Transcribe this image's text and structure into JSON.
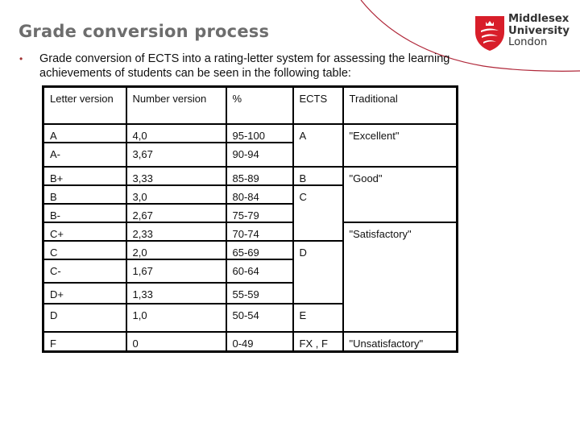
{
  "slide": {
    "title": "Grade conversion process",
    "bullet_symbol": "•",
    "bullet_text": "Grade conversion of ECTS into a rating-letter system for assessing the learning achievements of students can be seen in the following table:"
  },
  "logo": {
    "line1": "Middlesex",
    "line2": "University",
    "line3": "London",
    "brand_color": "#d81e2a"
  },
  "table": {
    "headers": [
      "Letter version",
      "Number version",
      "%",
      "ECTS",
      "Traditional"
    ],
    "rows": [
      {
        "letter": "A",
        "number": "4,0",
        "percent": "95-100"
      },
      {
        "letter": "A-",
        "number": "3,67",
        "percent": "90-94"
      },
      {
        "letter": "B+",
        "number": "3,33",
        "percent": "85-89"
      },
      {
        "letter": "B",
        "number": "3,0",
        "percent": "80-84"
      },
      {
        "letter": "B-",
        "number": "2,67",
        "percent": "75-79"
      },
      {
        "letter": "C+",
        "number": "2,33",
        "percent": "70-74"
      },
      {
        "letter": "C",
        "number": "2,0",
        "percent": "65-69"
      },
      {
        "letter": "C-",
        "number": "1,67",
        "percent": "60-64"
      },
      {
        "letter": "D+",
        "number": "1,33",
        "percent": "55-59"
      },
      {
        "letter": "D",
        "number": "1,0",
        "percent": "50-54"
      },
      {
        "letter": "F",
        "number": "0",
        "percent": "0-49"
      }
    ],
    "ects": [
      "A",
      "B",
      "C",
      "D",
      "E",
      "FX , F"
    ],
    "traditional": [
      "\"Excellent\"",
      "\"Good\"",
      "\"Satisfactory\"",
      "\"Unsatisfactory\""
    ]
  }
}
